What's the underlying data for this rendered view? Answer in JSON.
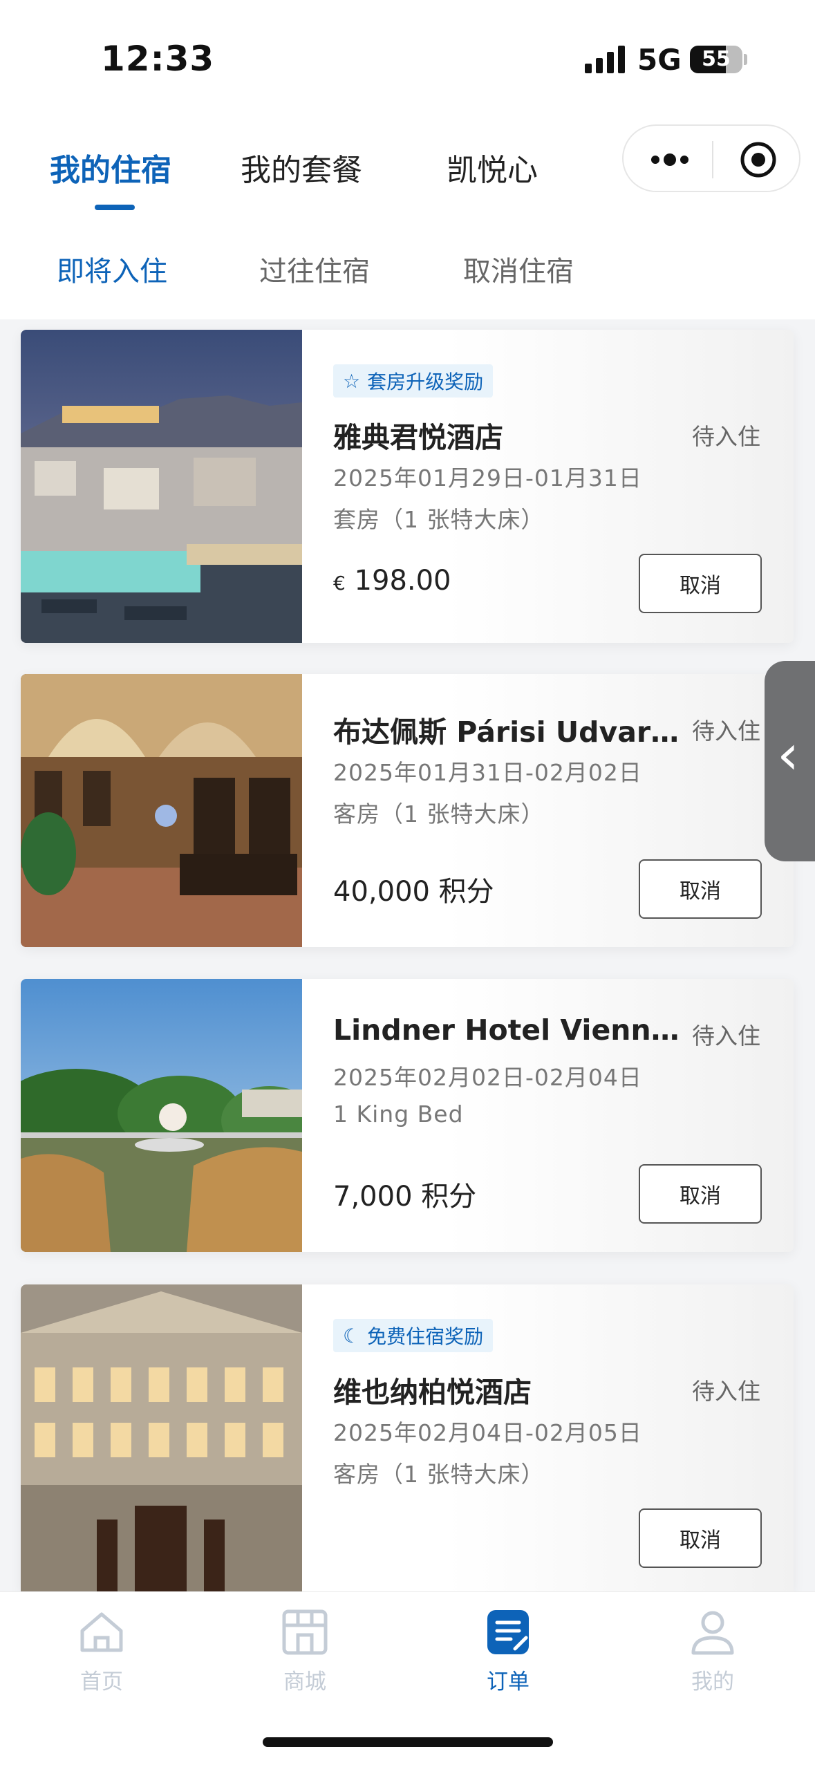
{
  "status_bar": {
    "time": "12:33",
    "network": "5G",
    "battery": "55"
  },
  "tabs": {
    "main": [
      {
        "label": "我的住宿",
        "active": true
      },
      {
        "label": "我的套餐",
        "active": false
      },
      {
        "label": "凯悦心",
        "active": false
      }
    ],
    "sub": [
      {
        "label": "即将入住",
        "active": true
      },
      {
        "label": "过往住宿",
        "active": false
      },
      {
        "label": "取消住宿",
        "active": false
      }
    ]
  },
  "capsule": {
    "more_icon": "more-dots-icon",
    "close_icon": "target-icon"
  },
  "bookings": [
    {
      "badge": "套房升级奖励",
      "badge_icon": "star-icon",
      "name": "雅典君悦酒店",
      "status": "待入住",
      "dates": "2025年01月29日-01月31日",
      "room": "套房（1 张特大床）",
      "currency": "€",
      "price": "198.00",
      "cancel": "取消"
    },
    {
      "name": "布达佩斯 Párisi Udvar Hotel Budapest",
      "status": "待入住",
      "dates": "2025年01月31日-02月02日",
      "room": "客房（1 张特大床）",
      "price": "40,000 积分",
      "cancel": "取消"
    },
    {
      "name": "Lindner Hotel Vienna Am Belvedere",
      "status": "待入住",
      "dates": "2025年02月02日-02月04日",
      "room": "1 King Bed",
      "price": "7,000 积分",
      "cancel": "取消"
    },
    {
      "badge": "免费住宿奖励",
      "badge_icon": "moon-icon",
      "name": "维也纳柏悦酒店",
      "status": "待入住",
      "dates": "2025年02月04日-02月05日",
      "room": "客房（1 张特大床）",
      "cancel": "取消"
    }
  ],
  "bottom_nav": [
    {
      "label": "首页",
      "icon": "home-icon",
      "active": false
    },
    {
      "label": "商城",
      "icon": "store-icon",
      "active": false
    },
    {
      "label": "订单",
      "icon": "orders-icon",
      "active": true
    },
    {
      "label": "我的",
      "icon": "profile-icon",
      "active": false
    }
  ],
  "colors": {
    "accent": "#0d63b8",
    "badge_bg": "#e8f3fb",
    "nav_inactive": "#c4ccd6"
  }
}
